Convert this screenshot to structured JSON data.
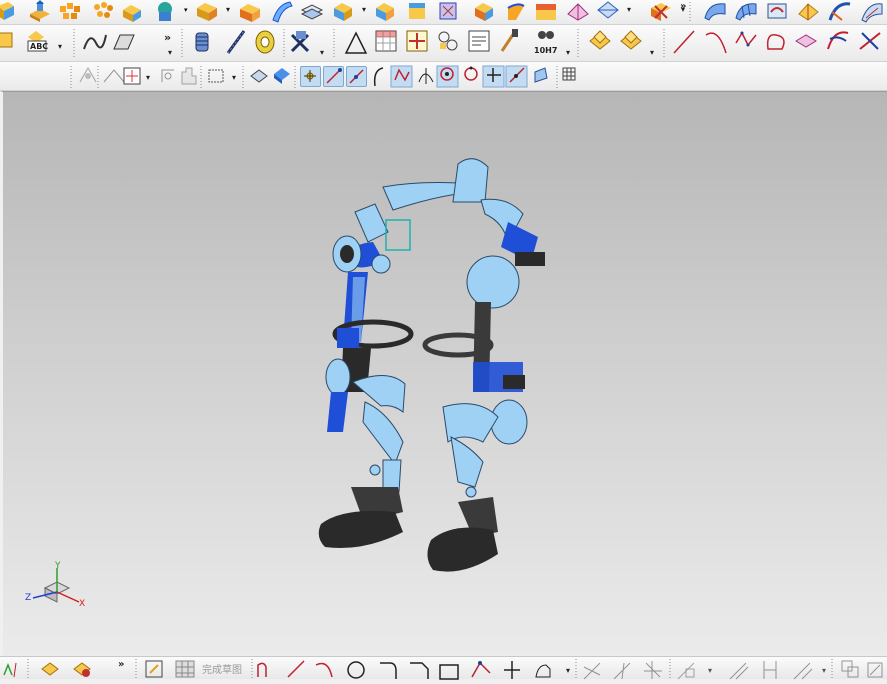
{
  "window": {
    "title": ""
  },
  "toolbar_row2": {
    "tolerance_label": "10H7"
  },
  "bottom_toolbar": {
    "finish_sketch_label": "完成草图"
  },
  "triad": {
    "x_label": "X",
    "y_label": "Y",
    "z_label": "Z"
  },
  "viewport": {
    "model": "exoskeleton-assembly"
  },
  "icons": {
    "row1": [
      "block-icon",
      "extrude-icon",
      "pattern-icon",
      "boolean-icon",
      "shape-icon",
      "edge-blend-icon",
      "chamfer-icon",
      "sweep-icon",
      "shell-icon",
      "offset-face-icon",
      "trim-body-icon",
      "draft-icon",
      "mirror-icon",
      "thread-icon",
      "split-body-icon",
      "delete-face-icon",
      "surface-icon",
      "mesh-surface-icon",
      "swept-surface-icon",
      "studio-surface-icon",
      "styled-blend-icon"
    ],
    "row2": [
      "part-navigator-icon",
      "text-icon",
      "rib-icon",
      "emboss-icon",
      "coil-icon",
      "spring-icon",
      "gasket-icon",
      "tube-icon",
      "triangle-icon",
      "table-icon",
      "gear-icon",
      "assembly-icon",
      "note-icon",
      "paint-icon",
      "tolerance-icon",
      "component-icon",
      "add-component-icon",
      "line-icon",
      "arc-icon",
      "spline-icon",
      "curve-icon",
      "bridge-curve-icon",
      "offset-curve-icon",
      "extract-curve-icon"
    ],
    "row3": [
      "snap-icon",
      "transform-icon",
      "select-grid-icon",
      "rotate-icon",
      "hand-icon",
      "select-box-icon",
      "body-icon",
      "face-icon",
      "point-snap-icon",
      "endpoint-icon",
      "midpoint-icon",
      "control-point-icon",
      "intersection-icon",
      "tangent-icon",
      "center-icon",
      "quadrant-icon",
      "existing-point-icon",
      "point-on-curve-icon",
      "view-snap-icon",
      "grid-icon"
    ],
    "bottom": [
      "sketch-icon",
      "constraint-icon",
      "profile-icon",
      "finish-sketch-icon",
      "line-icon",
      "arc-icon",
      "circle-icon",
      "fillet-icon",
      "rectangle-icon",
      "polyline-icon",
      "point-icon",
      "offset-icon",
      "quick-trim-icon",
      "quick-extend-icon",
      "make-corner-icon",
      "dimension-icon",
      "geometric-constraint-icon",
      "display-constraint-icon",
      "convert-ref-icon",
      "alt-solution-icon"
    ]
  },
  "colors": {
    "accent": "#1f4fd6",
    "part_light": "#9fd1f5",
    "part_dark": "#2a2a2a",
    "highlight": "#c3dcf2"
  }
}
